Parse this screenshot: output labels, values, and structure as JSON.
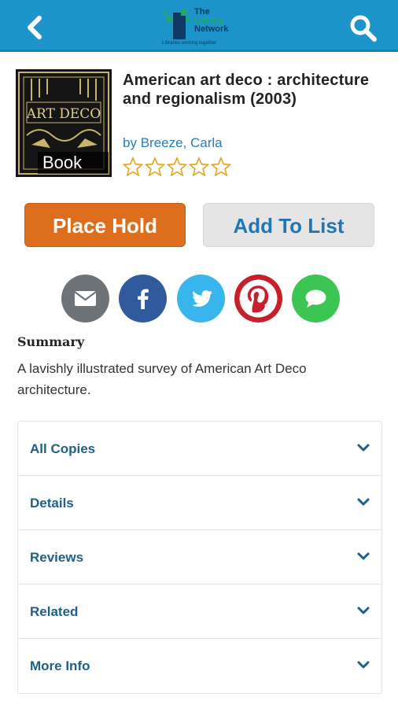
{
  "header": {
    "logo_line1": "The",
    "logo_line2": "Library",
    "logo_line3": "Network",
    "logo_tagline": "Libraries working together",
    "back_icon": "chevron-left-icon",
    "search_icon": "search-icon",
    "bar_color": "#1d94c9"
  },
  "item": {
    "title": "American art deco : architecture and regionalism (2003)",
    "author_prefix": "by",
    "author": "Breeze, Carla",
    "format": "Book",
    "cover_art_text": "ART DECO",
    "rating_stars": 0,
    "rating_max": 5
  },
  "actions": {
    "place_hold": "Place Hold",
    "add_to_list": "Add To List",
    "hold_color": "#dc6e1e"
  },
  "share": [
    {
      "icon": "email-icon",
      "color": "#6e7378"
    },
    {
      "icon": "facebook-icon",
      "color": "#2f5a9e"
    },
    {
      "icon": "twitter-icon",
      "color": "#39b5ee"
    },
    {
      "icon": "pinterest-icon",
      "color": "#c8202a"
    },
    {
      "icon": "sms-icon",
      "color": "#3cc553"
    }
  ],
  "summary": {
    "heading": "Summary",
    "text": "A lavishly illustrated survey of American Art Deco architecture."
  },
  "sections": [
    {
      "label": "All Copies"
    },
    {
      "label": "Details"
    },
    {
      "label": "Reviews"
    },
    {
      "label": "Related"
    },
    {
      "label": "More Info"
    }
  ]
}
